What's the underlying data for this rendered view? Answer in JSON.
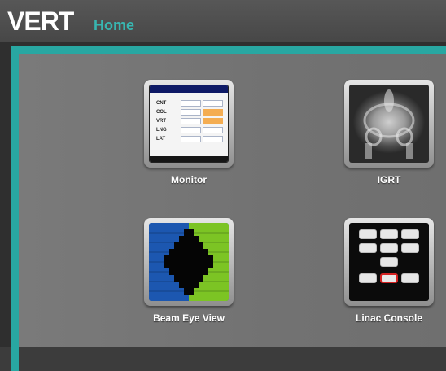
{
  "header": {
    "app_name": "VERT",
    "section": "Home"
  },
  "tiles": [
    {
      "label": "Monitor",
      "icon": "monitor-icon"
    },
    {
      "label": "IGRT",
      "icon": "igrt-xray-icon"
    },
    {
      "label": "Beam Eye View",
      "icon": "beam-eye-view-icon"
    },
    {
      "label": "Linac Console",
      "icon": "linac-console-icon"
    }
  ],
  "monitor_rows": [
    "CNT",
    "COL",
    "VRT",
    "LNG",
    "LAT"
  ],
  "colors": {
    "accent": "#28a7a2",
    "title_sub": "#38b5b0",
    "highlight": "#f4ad52",
    "linac_active": "#d42222"
  }
}
